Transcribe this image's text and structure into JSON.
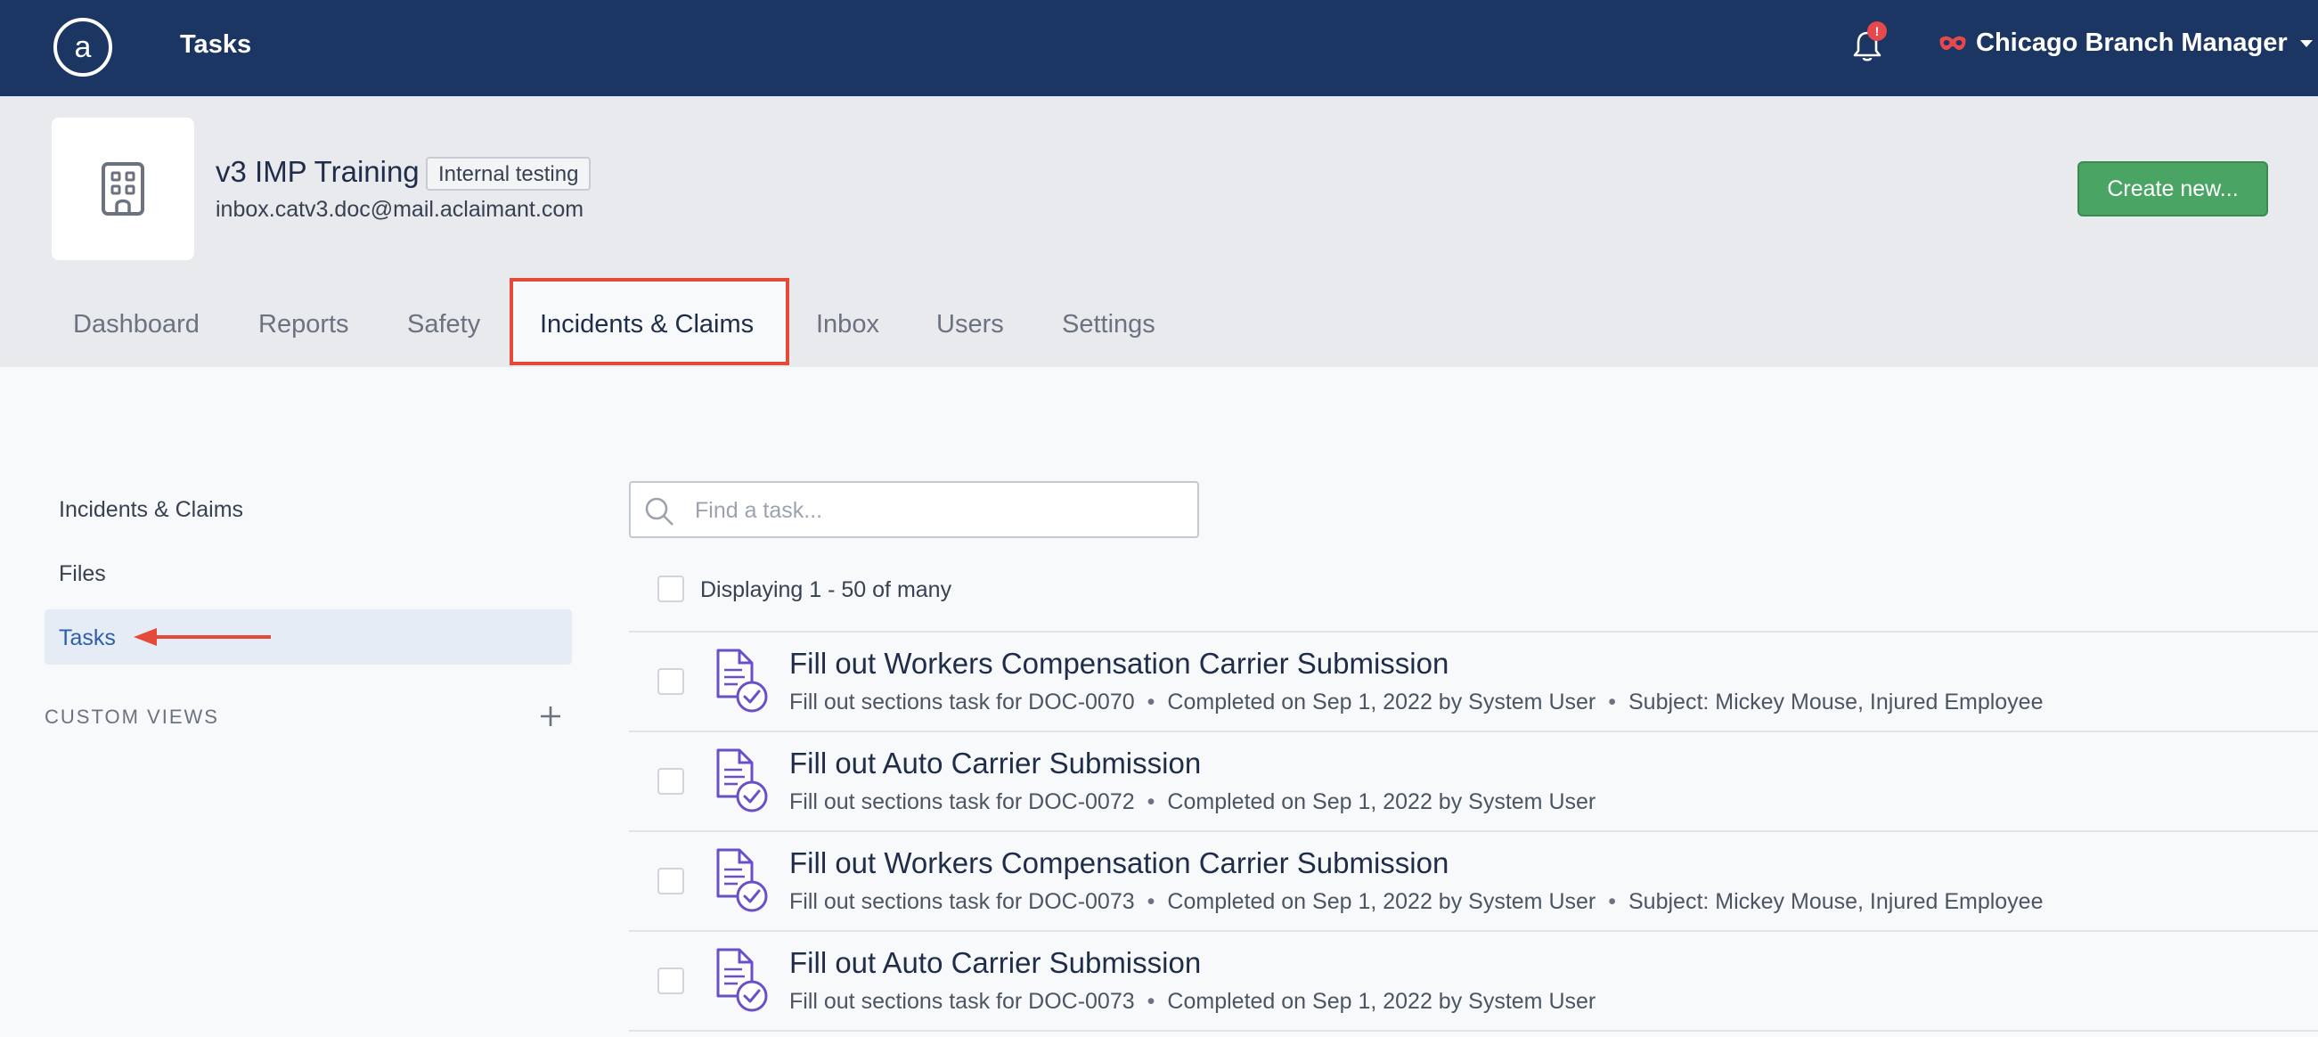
{
  "topbar": {
    "title": "Tasks",
    "notification_badge": "!",
    "user_name": "Chicago Branch Manager"
  },
  "org": {
    "name": "v3 IMP Training",
    "badge": "Internal testing",
    "email": "inbox.catv3.doc@mail.aclaimant.com",
    "create_label": "Create new..."
  },
  "tabs": [
    {
      "label": "Dashboard"
    },
    {
      "label": "Reports"
    },
    {
      "label": "Safety"
    },
    {
      "label": "Incidents & Claims",
      "active": true
    },
    {
      "label": "Inbox"
    },
    {
      "label": "Users"
    },
    {
      "label": "Settings"
    }
  ],
  "sidebar": {
    "items": [
      {
        "label": "Incidents & Claims"
      },
      {
        "label": "Files"
      },
      {
        "label": "Tasks",
        "active": true
      }
    ],
    "custom_views_label": "CUSTOM VIEWS"
  },
  "main": {
    "search_placeholder": "Find a task...",
    "display_count": "Displaying 1 - 50 of many",
    "tasks": [
      {
        "title": "Fill out Workers Compensation Carrier Submission",
        "task_ref": "Fill out sections task for DOC-0070",
        "completed": "Completed on Sep 1, 2022 by System User",
        "subject": "Subject: Mickey Mouse, Injured Employee"
      },
      {
        "title": "Fill out Auto Carrier Submission",
        "task_ref": "Fill out sections task for DOC-0072",
        "completed": "Completed on Sep 1, 2022 by System User",
        "subject": ""
      },
      {
        "title": "Fill out Workers Compensation Carrier Submission",
        "task_ref": "Fill out sections task for DOC-0073",
        "completed": "Completed on Sep 1, 2022 by System User",
        "subject": "Subject: Mickey Mouse, Injured Employee"
      },
      {
        "title": "Fill out Auto Carrier Submission",
        "task_ref": "Fill out sections task for DOC-0073",
        "completed": "Completed on Sep 1, 2022 by System User",
        "subject": ""
      }
    ]
  },
  "colors": {
    "topbar": "#1c3664",
    "accent_green": "#4aa564",
    "highlight_red": "#e5493a",
    "task_icon_purple": "#6b4fc8",
    "active_link": "#2d5fa8"
  }
}
